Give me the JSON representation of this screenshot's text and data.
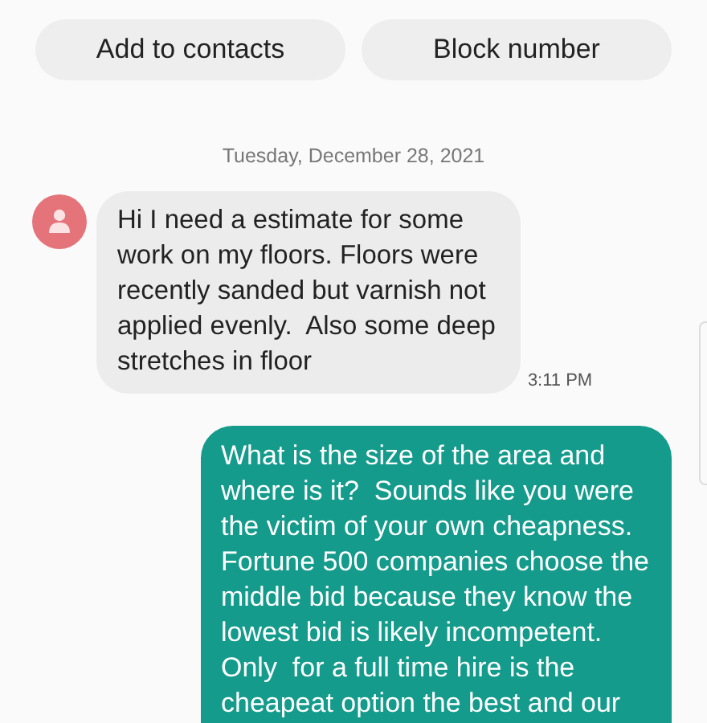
{
  "actions": [
    "Add to contacts",
    "Block number"
  ],
  "date": "Tuesday, December 28, 2021",
  "messages": [
    {
      "kind": "received",
      "lines": [
        "Hi I need a estimate for some",
        "work on my floors. Floors were",
        "recently sanded but varnish not",
        "applied evenly.  Also some deep",
        "stretches in floor"
      ],
      "time": "3:11 PM"
    },
    {
      "kind": "sent",
      "lines": [
        "What is the size of the area and",
        "where is it?  Sounds like you were",
        "the victim of your own cheapness.",
        "Fortune 500 companies choose the",
        "middle bid because they know the",
        "lowest bid is likely incompetent.",
        "Only  for a full time hire is the",
        "cheapeat option the best and our"
      ]
    }
  ]
}
